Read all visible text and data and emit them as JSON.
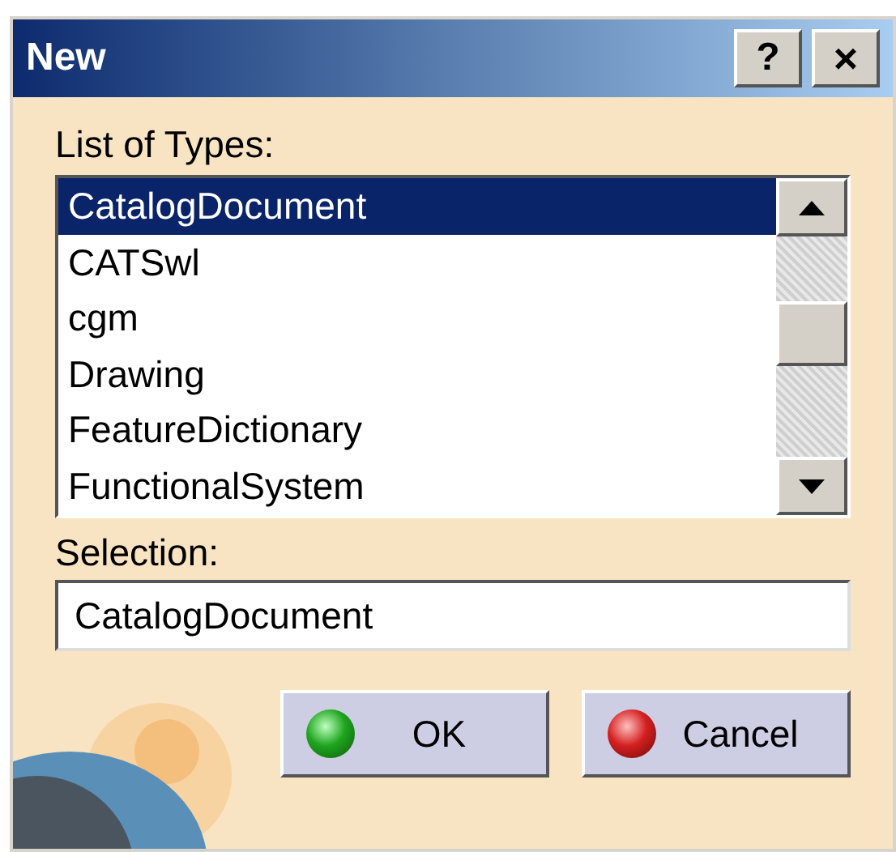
{
  "window": {
    "title": "New",
    "help_button": "?",
    "close_button": "×"
  },
  "list_label": "List of Types:",
  "types": [
    {
      "label": "CatalogDocument",
      "selected": true
    },
    {
      "label": "CATSwl",
      "selected": false
    },
    {
      "label": "cgm",
      "selected": false
    },
    {
      "label": "Drawing",
      "selected": false
    },
    {
      "label": "FeatureDictionary",
      "selected": false
    },
    {
      "label": "FunctionalSystem",
      "selected": false
    }
  ],
  "selection_label": "Selection:",
  "selection": {
    "value": "CatalogDocument"
  },
  "buttons": [
    {
      "kind": "ok",
      "label": "OK"
    },
    {
      "kind": "cancel",
      "label": "Cancel"
    }
  ]
}
